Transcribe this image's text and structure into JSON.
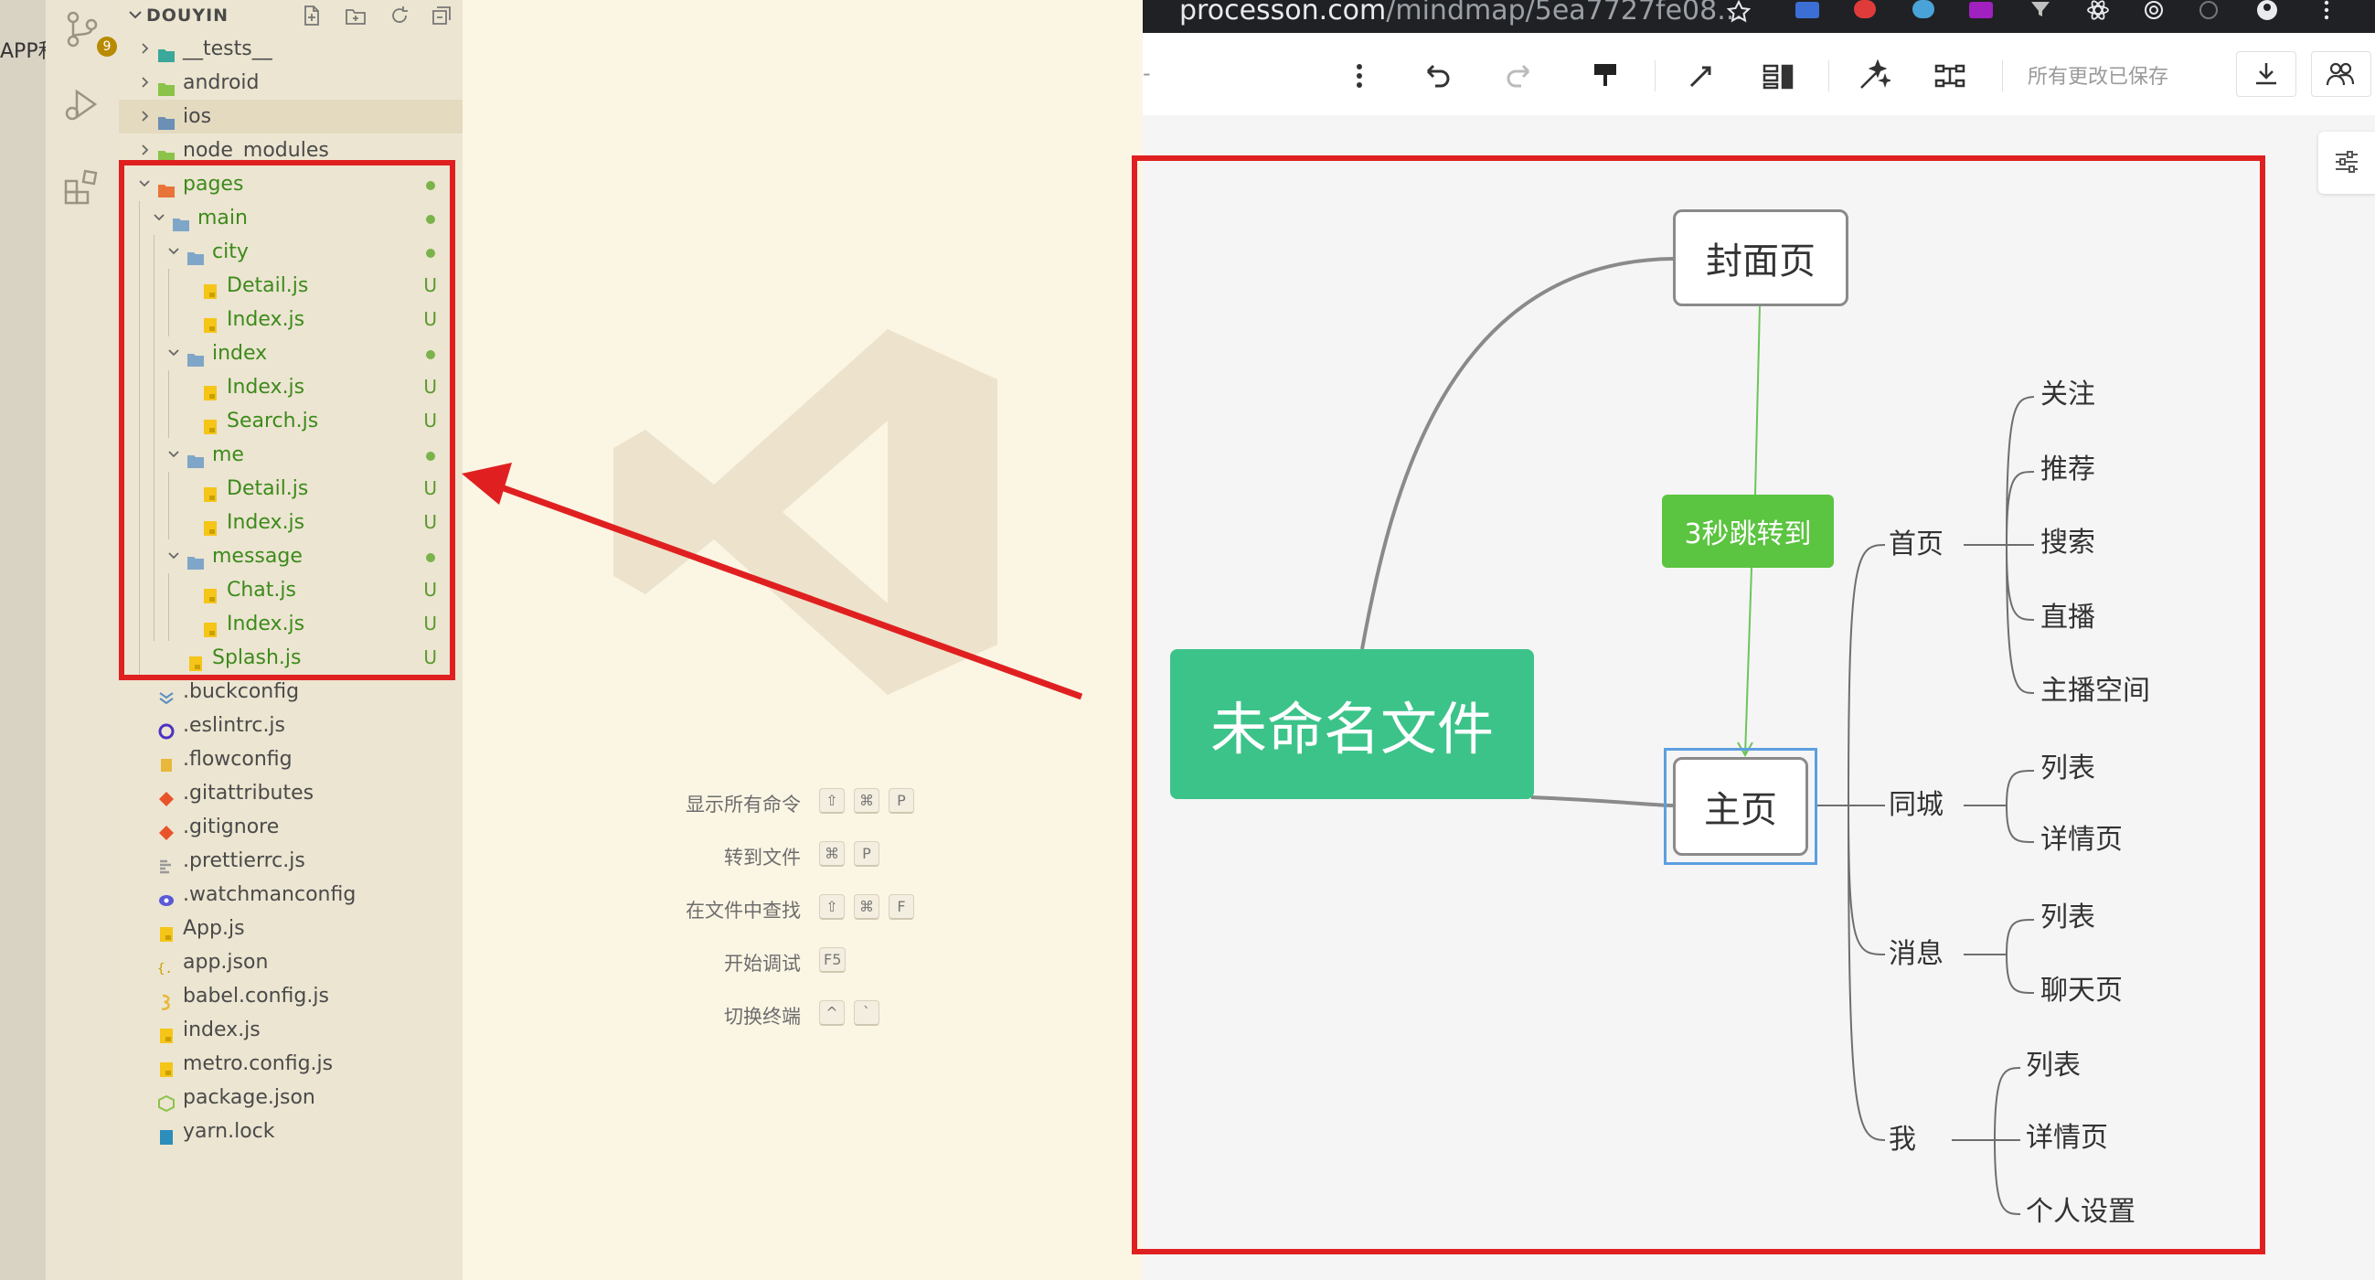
{
  "left_app": {
    "partial_title": "APP和"
  },
  "activity_bar": {
    "scm_badge": "9"
  },
  "explorer": {
    "title": "DOUYIN",
    "rows": [
      {
        "label": "__tests__",
        "type": "folder-test",
        "indent": 0,
        "chevron": "right"
      },
      {
        "label": "android",
        "type": "folder-android",
        "indent": 0,
        "chevron": "right"
      },
      {
        "label": "ios",
        "type": "folder-ios",
        "indent": 0,
        "chevron": "right",
        "selected": true
      },
      {
        "label": "node_modules",
        "type": "folder-node",
        "indent": 0,
        "chevron": "right"
      },
      {
        "label": "pages",
        "type": "folder-pages",
        "indent": 0,
        "chevron": "down",
        "dot": true,
        "green": true
      },
      {
        "label": "main",
        "type": "folder",
        "indent": 1,
        "chevron": "down",
        "dot": true,
        "green": true
      },
      {
        "label": "city",
        "type": "folder",
        "indent": 2,
        "chevron": "down",
        "dot": true,
        "green": true
      },
      {
        "label": "Detail.js",
        "type": "js",
        "indent": 3,
        "status": "U",
        "green": true
      },
      {
        "label": "Index.js",
        "type": "js",
        "indent": 3,
        "status": "U",
        "green": true
      },
      {
        "label": "index",
        "type": "folder",
        "indent": 2,
        "chevron": "down",
        "dot": true,
        "green": true
      },
      {
        "label": "Index.js",
        "type": "js",
        "indent": 3,
        "status": "U",
        "green": true
      },
      {
        "label": "Search.js",
        "type": "js",
        "indent": 3,
        "status": "U",
        "green": true
      },
      {
        "label": "me",
        "type": "folder",
        "indent": 2,
        "chevron": "down",
        "dot": true,
        "green": true
      },
      {
        "label": "Detail.js",
        "type": "js",
        "indent": 3,
        "status": "U",
        "green": true
      },
      {
        "label": "Index.js",
        "type": "js",
        "indent": 3,
        "status": "U",
        "green": true
      },
      {
        "label": "message",
        "type": "folder",
        "indent": 2,
        "chevron": "down",
        "dot": true,
        "green": true
      },
      {
        "label": "Chat.js",
        "type": "js",
        "indent": 3,
        "status": "U",
        "green": true
      },
      {
        "label": "Index.js",
        "type": "js",
        "indent": 3,
        "status": "U",
        "green": true
      },
      {
        "label": "Splash.js",
        "type": "js",
        "indent": 2,
        "status": "U",
        "green": true
      },
      {
        "label": ".buckconfig",
        "type": "buck",
        "indent": 0
      },
      {
        "label": ".eslintrc.js",
        "type": "eslint",
        "indent": 0
      },
      {
        "label": ".flowconfig",
        "type": "flow",
        "indent": 0
      },
      {
        "label": ".gitattributes",
        "type": "git",
        "indent": 0
      },
      {
        "label": ".gitignore",
        "type": "git",
        "indent": 0
      },
      {
        "label": ".prettierrc.js",
        "type": "prettier",
        "indent": 0
      },
      {
        "label": ".watchmanconfig",
        "type": "watchman",
        "indent": 0
      },
      {
        "label": "App.js",
        "type": "js",
        "indent": 0
      },
      {
        "label": "app.json",
        "type": "json",
        "indent": 0
      },
      {
        "label": "babel.config.js",
        "type": "babel",
        "indent": 0
      },
      {
        "label": "index.js",
        "type": "js",
        "indent": 0
      },
      {
        "label": "metro.config.js",
        "type": "js",
        "indent": 0
      },
      {
        "label": "package.json",
        "type": "npm",
        "indent": 0
      },
      {
        "label": "yarn.lock",
        "type": "yarn",
        "indent": 0
      }
    ]
  },
  "welcome": {
    "commands": [
      {
        "label": "显示所有命令",
        "keys": [
          "⇧",
          "⌘",
          "P"
        ]
      },
      {
        "label": "转到文件",
        "keys": [
          "⌘",
          "P"
        ]
      },
      {
        "label": "在文件中查找",
        "keys": [
          "⇧",
          "⌘",
          "F"
        ]
      },
      {
        "label": "开始调试",
        "keys": [
          "F5"
        ]
      },
      {
        "label": "切换终端",
        "keys": [
          "^",
          "`"
        ]
      }
    ]
  },
  "browser": {
    "url_host": "processon.com",
    "url_path": "/mindmap/5ea7727fe08...",
    "save_status": "所有更改已保存"
  },
  "mindmap": {
    "root": "未命名文件",
    "cover": "封面页",
    "jump_label": "3秒跳转到",
    "home": "主页",
    "branches": [
      {
        "label": "首页",
        "children": [
          "关注",
          "推荐",
          "搜索",
          "直播",
          "主播空间"
        ]
      },
      {
        "label": "同城",
        "children": [
          "列表",
          "详情页"
        ]
      },
      {
        "label": "消息",
        "children": [
          "列表",
          "聊天页"
        ]
      },
      {
        "label": "我",
        "children": [
          "列表",
          "详情页",
          "个人设置"
        ]
      }
    ]
  },
  "colors": {
    "root_green": "#3cc38a",
    "jump_green": "#5bc440",
    "annotation_red": "#e02020",
    "git_untracked": "#5a9a2e",
    "selection_blue": "#5b9fe0"
  }
}
